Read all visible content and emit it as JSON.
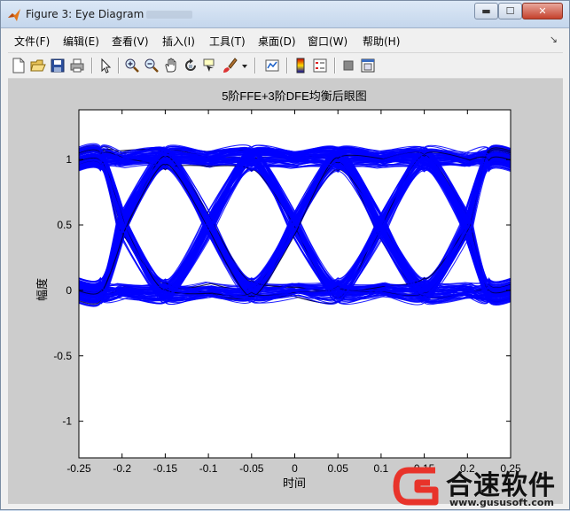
{
  "window": {
    "title": "Figure 3: Eye Diagram",
    "minimize_glyph": "▬",
    "maximize_glyph": "☐",
    "close_glyph": "✕"
  },
  "menu": {
    "items": [
      "文件(F)",
      "编辑(E)",
      "查看(V)",
      "插入(I)",
      "工具(T)",
      "桌面(D)",
      "窗口(W)",
      "帮助(H)"
    ],
    "dock_arrow": "↘"
  },
  "toolbar": {
    "icons": [
      "new-figure-icon",
      "open-file-icon",
      "save-icon",
      "print-icon",
      "edit-plot-arrow-icon",
      "zoom-in-icon",
      "zoom-out-icon",
      "pan-hand-icon",
      "rotate-3d-icon",
      "data-cursor-icon",
      "brush-icon",
      "brush-dropdown-icon",
      "link-plot-icon",
      "colorbar-icon",
      "legend-icon",
      "hide-plot-tools-icon",
      "show-plot-tools-icon"
    ]
  },
  "chart_data": {
    "type": "line",
    "title": "5阶FFE+3阶DFE均衡后眼图",
    "xlabel": "时间",
    "ylabel": "幅度",
    "xlim": [
      -0.25,
      0.25
    ],
    "ylim": [
      -1.28,
      1.38
    ],
    "xticks": [
      -0.25,
      -0.2,
      -0.15,
      -0.1,
      -0.05,
      0,
      0.05,
      0.1,
      0.15,
      0.2,
      0.25
    ],
    "xtick_labels": [
      "-0.25",
      "-0.2",
      "-0.15",
      "-0.1",
      "-0.05",
      "0",
      "0.05",
      "0.1",
      "0.15",
      "0.2",
      "0.25"
    ],
    "yticks": [
      -1,
      -0.5,
      0,
      0.5,
      1
    ],
    "ytick_labels": [
      "-1",
      "-0.5",
      "0",
      "0.5",
      "1"
    ],
    "series_color": "#0000ff",
    "symbol_levels": [
      0,
      1
    ],
    "crossing_times": [
      -0.2,
      -0.1,
      0,
      0.1,
      0.2
    ],
    "crossing_level": 0.5,
    "noise_band": 0.14
  },
  "watermark": {
    "name": "合速软件",
    "url": "www.gususoft.com",
    "color": "#e8332a"
  }
}
